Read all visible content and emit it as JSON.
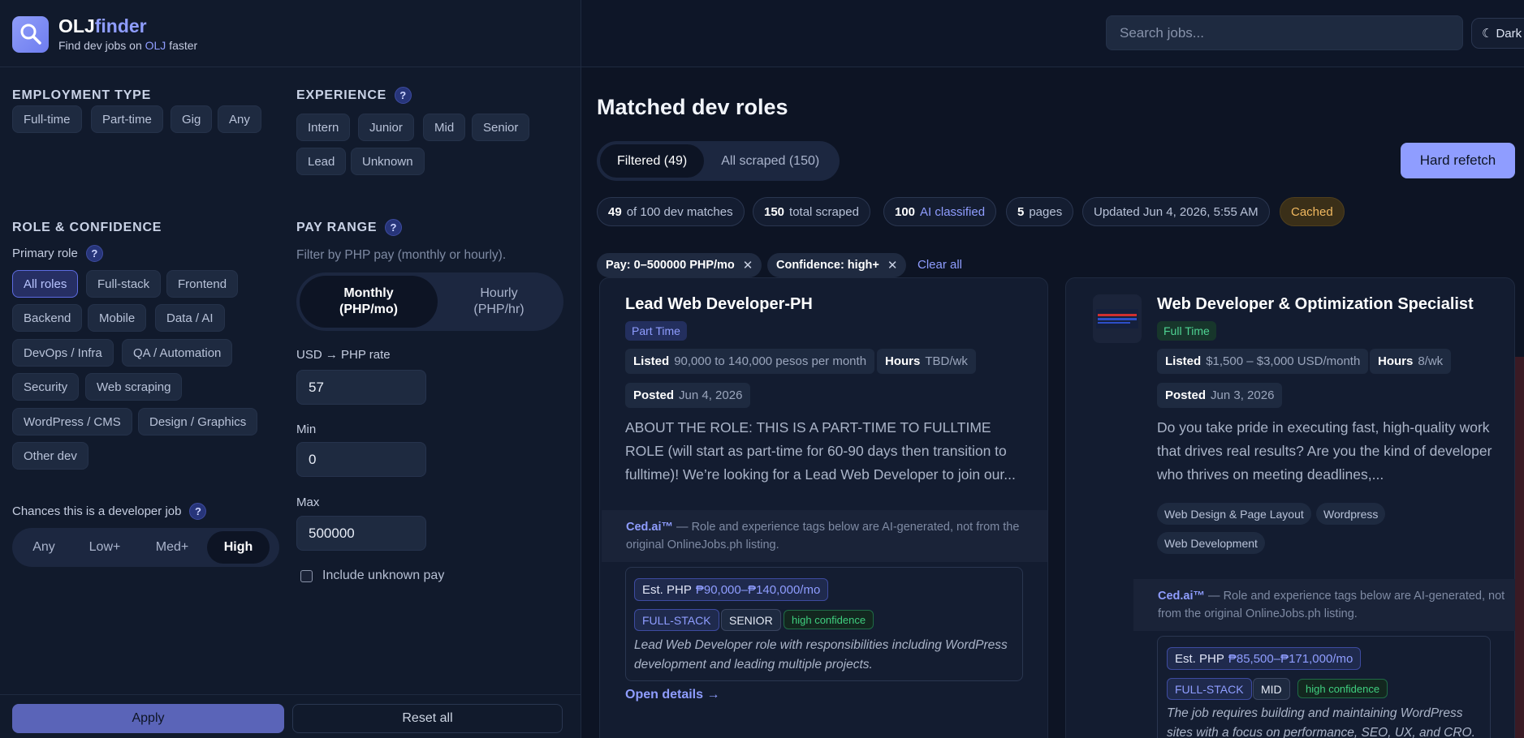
{
  "brand": {
    "name_prefix": "OLJ",
    "name_suffix": "finder",
    "sub_pre": "Find dev jobs on ",
    "sub_olj": "OLJ",
    "sub_post": " faster",
    "logo_icon": "search-icon"
  },
  "filters": {
    "employment": {
      "title": "EMPLOYMENT TYPE",
      "options": [
        "Full-time",
        "Part-time",
        "Gig",
        "Any"
      ]
    },
    "experience": {
      "title": "EXPERIENCE",
      "help": "?",
      "options": [
        "Intern",
        "Junior",
        "Mid",
        "Senior",
        "Lead",
        "Unknown"
      ]
    },
    "role": {
      "title": "ROLE & CONFIDENCE",
      "primary_label": "Primary role",
      "help": "?",
      "options": [
        "All roles",
        "Full-stack",
        "Frontend",
        "Backend",
        "Mobile",
        "Data / AI",
        "DevOps / Infra",
        "QA / Automation",
        "Security",
        "Web scraping",
        "WordPress / CMS",
        "Design / Graphics",
        "Other dev"
      ],
      "selected": "All roles",
      "chances_label": "Chances this is a developer job",
      "chances": [
        "Any",
        "Low+",
        "Med+",
        "High"
      ],
      "chances_selected": "High"
    },
    "pay": {
      "title": "PAY RANGE",
      "help": "?",
      "hint": "Filter by PHP pay (monthly or hourly).",
      "monthly_line1": "Monthly",
      "monthly_line2": "(PHP/mo)",
      "hourly_line1": "Hourly",
      "hourly_line2": "(PHP/hr)",
      "selected": "Monthly",
      "rate_label": "USD → PHP rate",
      "rate_value": "57",
      "min_label": "Min",
      "min_value": "0",
      "max_label": "Max",
      "max_value": "500000",
      "include_unknown": "Include unknown pay",
      "include_unknown_checked": false
    },
    "apply_label": "Apply",
    "reset_label": "Reset all"
  },
  "topbar": {
    "search_placeholder": "Search jobs...",
    "theme_icon": "☾",
    "theme_label": "Dark"
  },
  "main": {
    "title": "Matched dev roles",
    "tabs": [
      {
        "label": "Filtered (49)"
      },
      {
        "label": "All scraped (150)"
      }
    ],
    "refetch_label": "Hard refetch",
    "stats": {
      "matches_num": "49",
      "matches_text": "of 100 dev matches",
      "scraped_num": "150",
      "scraped_text": "total scraped",
      "ai_num": "100",
      "ai_text": "AI classified",
      "pages_num": "5",
      "pages_text": "pages",
      "updated": "Updated Jun 4, 2026, 5:55 AM",
      "cached": "Cached"
    },
    "active_filters": [
      "Pay: 0–500000 PHP/mo",
      "Confidence: high+"
    ],
    "clear_all": "Clear all"
  },
  "jobs": [
    {
      "title": "Lead Web Developer-PH",
      "type": "Part Time",
      "listed_label": "Listed",
      "listed": "90,000 to 140,000 pesos per month",
      "hours_label": "Hours",
      "hours": "TBD/wk",
      "posted_label": "Posted",
      "posted": "Jun 4, 2026",
      "description": "ABOUT THE ROLE: THIS IS A PART-TIME TO FULLTIME ROLE (will start as part-time for 60-90 days then transition to fulltime)! We’re looking for a Lead Web Developer to join our...",
      "ai_brand": "Ced.ai™",
      "ai_note": " — Role and experience tags below are AI-generated, not from the original OnlineJobs.ph listing.",
      "est_label": "Est. PHP",
      "est_value": "₱90,000–₱140,000/mo",
      "role_tag": "FULL-STACK",
      "level_tag": "SENIOR",
      "confidence": "high confidence",
      "summary": "Lead Web Developer role with responsibilities including WordPress development and leading multiple projects.",
      "open_link": "Open details →"
    },
    {
      "title": "Web Developer & Optimization Specialist",
      "type": "Full Time",
      "listed_label": "Listed",
      "listed": "$1,500 – $3,000 USD/month",
      "hours_label": "Hours",
      "hours": "8/wk",
      "posted_label": "Posted",
      "posted": "Jun 3, 2026",
      "description": "Do you take pride in executing fast, high-quality work that drives real results? Are you the kind of developer who thrives on meeting deadlines,...",
      "skills": [
        "Web Design & Page Layout",
        "Wordpress",
        "Web Development"
      ],
      "ai_brand": "Ced.ai™",
      "ai_note": " — Role and experience tags below are AI-generated, not from the original OnlineJobs.ph listing.",
      "est_label": "Est. PHP",
      "est_value": "₱85,500–₱171,000/mo",
      "role_tag": "FULL-STACK",
      "level_tag": "MID",
      "confidence": "high confidence",
      "summary": "The job requires building and maintaining WordPress sites with a focus on performance, SEO, UX, and CRO.",
      "logo_icon": "company-logo-icon"
    }
  ],
  "colors": {
    "accent": "#8f9dff",
    "success": "#3fcf7f",
    "warning": "#f0b860",
    "bg": "#0d1424",
    "panel": "#111a2c"
  }
}
